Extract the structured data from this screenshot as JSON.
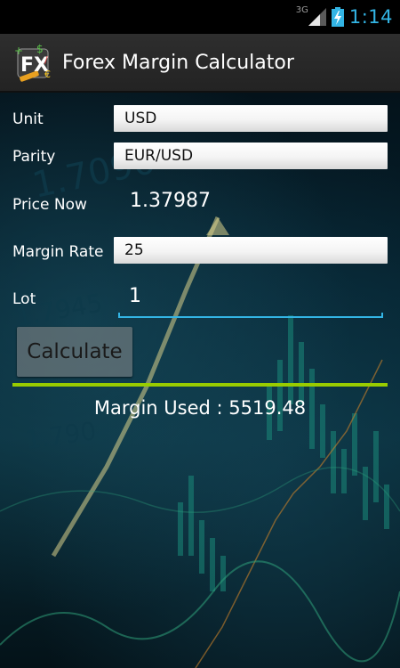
{
  "status_bar": {
    "network_type": "3G",
    "time": "1:14",
    "icons": [
      "signal-icon",
      "battery-charging-icon"
    ]
  },
  "action_bar": {
    "app_icon": "fx-app-icon",
    "title": "Forex Margin Calculator"
  },
  "form": {
    "unit": {
      "label": "Unit",
      "value": "USD"
    },
    "parity": {
      "label": "Parity",
      "value": "EUR/USD"
    },
    "price_now": {
      "label": "Price Now",
      "value": "1.37987"
    },
    "margin_rate": {
      "label": "Margin Rate",
      "value": "25"
    },
    "lot": {
      "label": "Lot",
      "value": "1"
    }
  },
  "calculate_button": {
    "label": "Calculate"
  },
  "result": {
    "text": "Margin Used : 5519.48"
  },
  "colors": {
    "status_clock": "#33b5e5",
    "focus_underline": "#33b5e5",
    "divider": "#99cc00",
    "background": "#062431"
  }
}
